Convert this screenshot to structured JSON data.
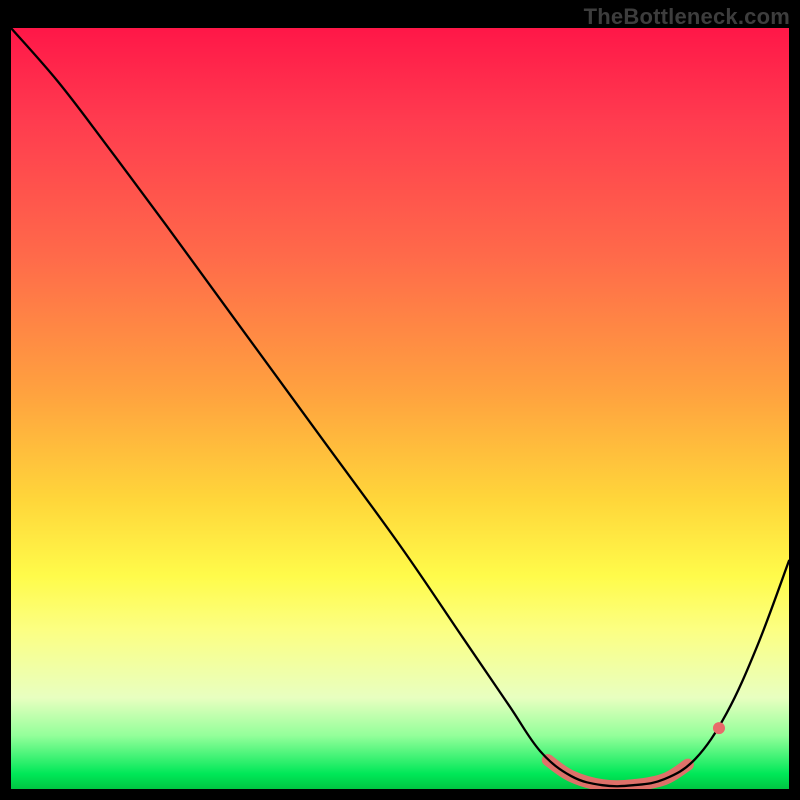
{
  "attribution": "TheBottleneck.com",
  "colors": {
    "curve": "#000000",
    "highlight": "#ea6a6a",
    "dot": "#e86a6a"
  },
  "chart_data": {
    "type": "line",
    "title": "",
    "xlabel": "",
    "ylabel": "",
    "xlim": [
      0,
      100
    ],
    "ylim": [
      0,
      100
    ],
    "grid": false,
    "legend": false,
    "curve": [
      {
        "x": 0,
        "y": 100
      },
      {
        "x": 6,
        "y": 93
      },
      {
        "x": 12,
        "y": 85
      },
      {
        "x": 20,
        "y": 74
      },
      {
        "x": 30,
        "y": 60
      },
      {
        "x": 40,
        "y": 46
      },
      {
        "x": 50,
        "y": 32
      },
      {
        "x": 58,
        "y": 20
      },
      {
        "x": 64,
        "y": 11
      },
      {
        "x": 68,
        "y": 5
      },
      {
        "x": 72,
        "y": 1.7
      },
      {
        "x": 76,
        "y": 0.5
      },
      {
        "x": 80,
        "y": 0.5
      },
      {
        "x": 84,
        "y": 1.3
      },
      {
        "x": 88,
        "y": 4
      },
      {
        "x": 92,
        "y": 10
      },
      {
        "x": 96,
        "y": 19
      },
      {
        "x": 100,
        "y": 30
      }
    ],
    "highlight_segment": [
      {
        "x": 69,
        "y": 3.8
      },
      {
        "x": 72,
        "y": 1.7
      },
      {
        "x": 76,
        "y": 0.5
      },
      {
        "x": 80,
        "y": 0.5
      },
      {
        "x": 84,
        "y": 1.3
      },
      {
        "x": 87,
        "y": 3.2
      }
    ],
    "highlight_dot": {
      "x": 91,
      "y": 8
    },
    "minimum": {
      "x": 78,
      "y": 0.4
    },
    "background_gradient": {
      "top": "#ff1748",
      "upper_mid": "#ffa23f",
      "mid": "#fffb4a",
      "lower_mid": "#e8ffc0",
      "bottom": "#00c542"
    }
  }
}
